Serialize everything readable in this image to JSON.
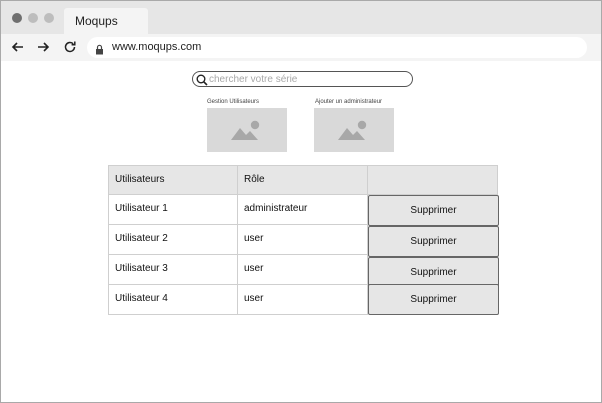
{
  "browser": {
    "tab_title": "Moqups",
    "url": "www.moqups.com"
  },
  "search": {
    "placeholder": "chercher votre série"
  },
  "cards": [
    {
      "label": "Gestion Utilisateurs"
    },
    {
      "label": "Ajouter un  administrateur"
    }
  ],
  "table": {
    "headers": [
      "Utilisateurs",
      "Rôle",
      ""
    ],
    "rows": [
      {
        "user": "Utilisateur 1",
        "role": "administrateur",
        "action": "Supprimer"
      },
      {
        "user": "Utilisateur 2",
        "role": "user",
        "action": "Supprimer"
      },
      {
        "user": "Utilisateur 3",
        "role": "user",
        "action": "Supprimer"
      },
      {
        "user": "Utilisateur 4",
        "role": "user",
        "action": "Supprimer"
      }
    ]
  }
}
